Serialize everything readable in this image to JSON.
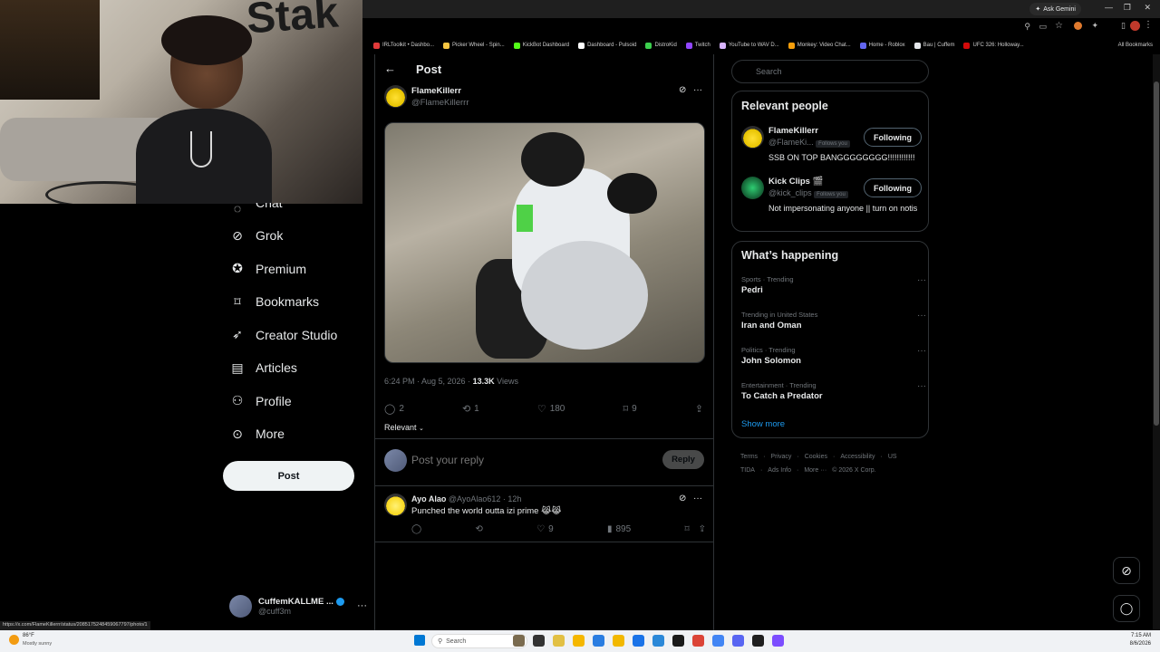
{
  "browser": {
    "ask_gemini": "Ask Gemini",
    "all_bookmarks": "All Bookmarks",
    "bookmarks": [
      {
        "label": "IRLToolkit • Dashbo...",
        "color": "#e03a3a"
      },
      {
        "label": "Picker Wheel - Spin...",
        "color": "#f5c542"
      },
      {
        "label": "KickBot Dashboard",
        "color": "#53fc18"
      },
      {
        "label": "Dashboard - Pulsoid",
        "color": "#ffffff"
      },
      {
        "label": "DistroKid",
        "color": "#3ccf4e"
      },
      {
        "label": "Twitch",
        "color": "#9146ff"
      },
      {
        "label": "YouTube to WAV D...",
        "color": "#d8b4fe"
      },
      {
        "label": "Monkey: Video Chat...",
        "color": "#f59e0b"
      },
      {
        "label": "Home - Roblox",
        "color": "#6366f1"
      },
      {
        "label": "Bau | Cuffem",
        "color": "#e5e7eb"
      },
      {
        "label": "UFC 326: Holloway...",
        "color": "#d20a0a"
      }
    ],
    "status_url": "https://x.com/FlameKillerrr/status/2085175248459067797/photo/1"
  },
  "sidebar": {
    "partial_item": "Chat",
    "items": [
      {
        "label": "Grok",
        "icon": "grok-icon"
      },
      {
        "label": "Premium",
        "icon": "premium-icon"
      },
      {
        "label": "Bookmarks",
        "icon": "bookmark-icon"
      },
      {
        "label": "Creator Studio",
        "icon": "rocket-icon"
      },
      {
        "label": "Articles",
        "icon": "articles-icon"
      },
      {
        "label": "Profile",
        "icon": "person-icon"
      },
      {
        "label": "More",
        "icon": "more-circle-icon"
      }
    ],
    "post_button": "Post",
    "account": {
      "name": "CuffemKALLME ...",
      "handle": "@cuff3m"
    }
  },
  "post": {
    "header": "Post",
    "author_name": "FlameKillerr",
    "author_handle": "@FlameKillerrr",
    "time": "6:24 PM · Aug 5, 2026 ·",
    "views_count": "13.3K",
    "views_label": "Views",
    "stats": {
      "replies": "2",
      "reposts": "1",
      "likes": "180",
      "bookmarks": "9"
    },
    "sort_label": "Relevant",
    "reply_placeholder": "Post your reply",
    "reply_button": "Reply"
  },
  "reply": {
    "name": "Ayo Alao",
    "handle": "@AyoAlao612",
    "time": "· 12h",
    "text": "Punched the world outta izi prime 😹😹",
    "likes": "9",
    "views": "895"
  },
  "right": {
    "search_placeholder": "Search",
    "relevant_title": "Relevant people",
    "people": [
      {
        "name": "FlameKillerr",
        "handle": "@FlameKi...",
        "follows": "Follows you",
        "button": "Following",
        "bio": "SSB ON TOP BANGGGGGGGG!!!!!!!!!!!!"
      },
      {
        "name": "Kick Clips 🎬",
        "handle": "@kick_clips",
        "follows": "Follows you",
        "button": "Following",
        "bio": "Not impersonating anyone || turn on notis"
      }
    ],
    "happening_title": "What’s happening",
    "trends": [
      {
        "meta": "Sports · Trending",
        "name": "Pedri"
      },
      {
        "meta": "Trending in United States",
        "name": "Iran and Oman"
      },
      {
        "meta": "Politics · Trending",
        "name": "John Solomon"
      },
      {
        "meta": "Entertainment · Trending",
        "name": "To Catch a Predator"
      }
    ],
    "show_more": "Show more",
    "footer": [
      "Terms",
      "·",
      "Privacy",
      "·",
      "Cookies",
      "·",
      "Accessibility",
      "·",
      "US TIDA",
      "·",
      "Ads Info",
      "·",
      "More ···",
      "© 2026 X Corp."
    ]
  },
  "taskbar": {
    "weather_temp": "86°F",
    "weather_desc": "Mostly sunny",
    "search_label": "Search",
    "time": "7:15 AM",
    "date": "8/6/2026"
  }
}
